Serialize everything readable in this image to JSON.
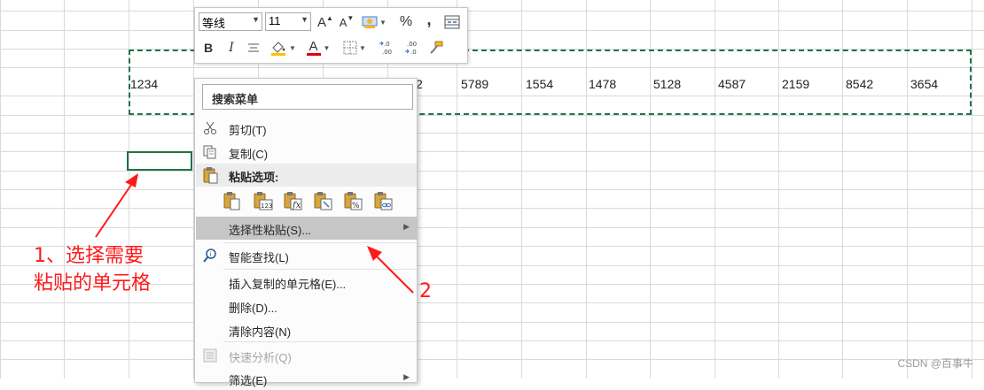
{
  "row_values": [
    "1234",
    "2",
    "5789",
    "1554",
    "1478",
    "5128",
    "4587",
    "2159",
    "8542",
    "3654"
  ],
  "mini_toolbar": {
    "font_name": "等线",
    "font_size": "11",
    "grow_font_glyph": "A",
    "shrink_font_glyph": "A",
    "percent_glyph": "%",
    "comma_glyph": ",",
    "bold_glyph": "B",
    "italic_glyph": "I",
    "font_color_glyph": "A",
    "font_color": "#e0000b",
    "fill_color": "#ffc000"
  },
  "context_menu": {
    "search_label": "搜索菜单",
    "items": {
      "cut": "剪切(T)",
      "copy": "复制(C)",
      "paste_options": "粘贴选项:",
      "paste_special": "选择性粘贴(S)...",
      "smart_lookup": "智能查找(L)",
      "insert_copied": "插入复制的单元格(E)...",
      "delete": "删除(D)...",
      "clear_contents": "清除内容(N)",
      "quick_analysis": "快速分析(Q)",
      "filter": "筛选(E)"
    }
  },
  "annotations": {
    "step1_line1": "1、选择需要",
    "step1_line2": "粘贴的单元格",
    "step2": "2"
  },
  "watermark": "CSDN @百事牛",
  "colors": {
    "excel_green": "#217346",
    "annotation_red": "#ff1a1a",
    "highlight": "#c6c6c6"
  }
}
